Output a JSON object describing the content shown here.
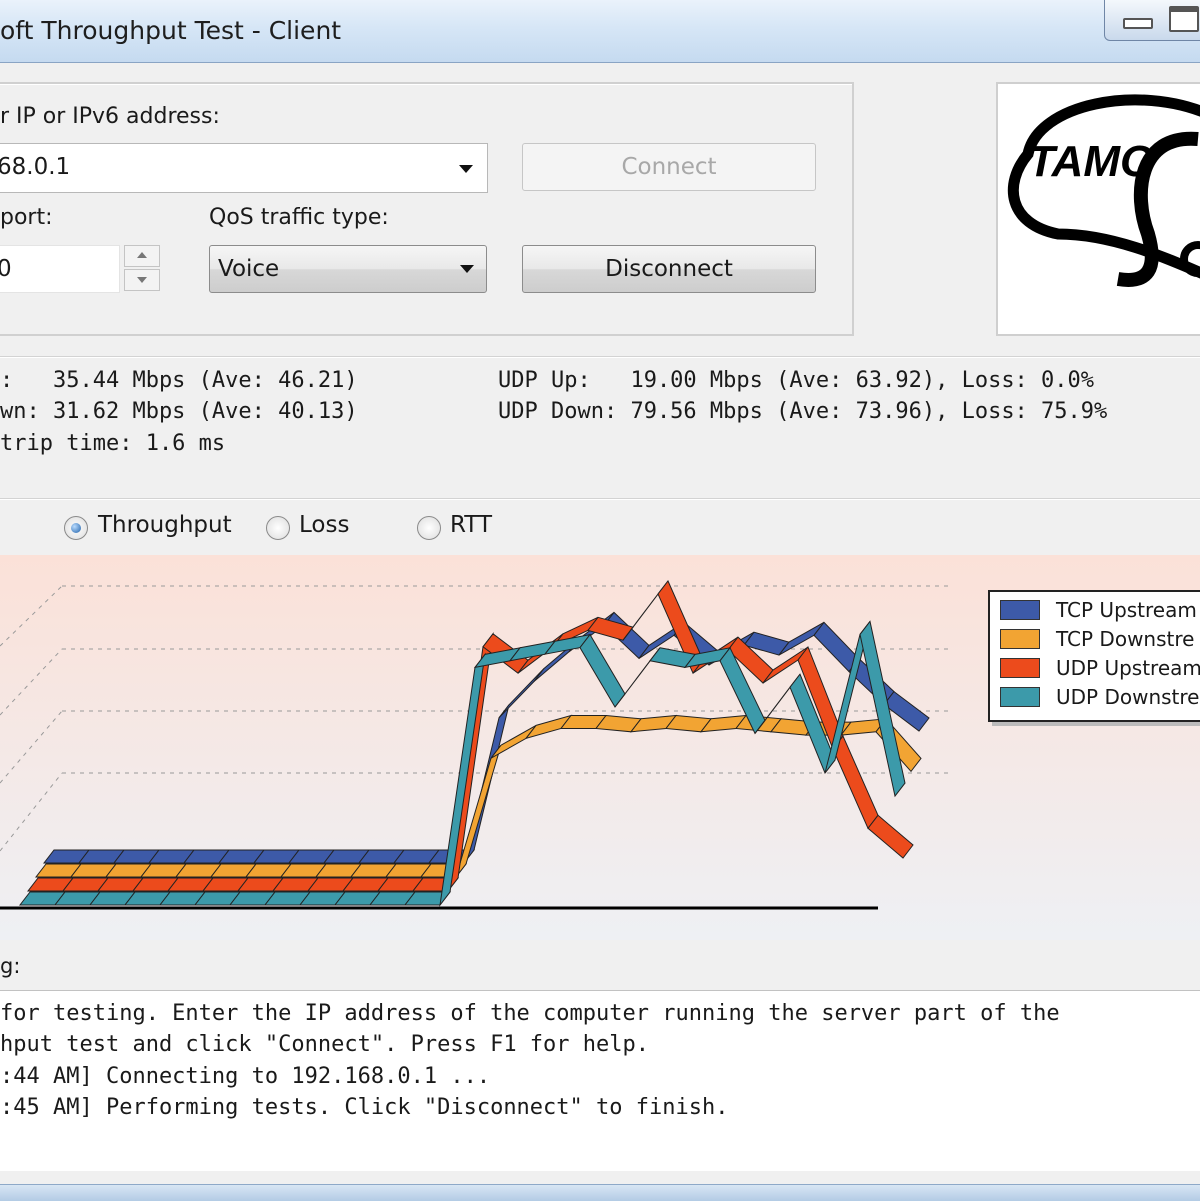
{
  "window": {
    "title": "oft Throughput Test - Client"
  },
  "connection": {
    "address_label": "r IP or IPv6  address:",
    "address_value": "68.0.1",
    "port_label": "port:",
    "port_value": "0",
    "qos_label": "QoS traffic type:",
    "qos_value": "Voice",
    "connect_label": "Connect",
    "disconnect_label": "Disconnect"
  },
  "logo": {
    "text": "TAMO"
  },
  "stats": {
    "line1_left": ":   35.44 Mbps (Ave: 46.21)",
    "line2_left": "wn: 31.62 Mbps (Ave: 40.13)",
    "line3_left": "trip time: 1.6 ms",
    "line1_right": "UDP Up:   19.00 Mbps (Ave: 63.92), Loss: 0.0%",
    "line2_right": "UDP Down: 79.56 Mbps (Ave: 73.96), Loss: 75.9%"
  },
  "view_options": [
    {
      "label": "Throughput",
      "selected": true
    },
    {
      "label": "Loss",
      "selected": false
    },
    {
      "label": "RTT",
      "selected": false
    }
  ],
  "legend": [
    {
      "label": "TCP Upstream",
      "color": "#3d5aa8"
    },
    {
      "label": "TCP Downstre",
      "color": "#f2a433"
    },
    {
      "label": "UDP Upstream",
      "color": "#ec4b1c"
    },
    {
      "label": "UDP Downstre",
      "color": "#3c9aaa"
    }
  ],
  "chart_data": {
    "type": "line",
    "title": "",
    "xlabel": "",
    "ylabel": "",
    "series": [
      {
        "name": "TCP Upstream",
        "values": [
          0,
          0,
          0,
          0,
          0,
          0,
          0,
          0,
          0,
          0,
          0,
          0,
          0,
          44,
          55,
          64,
          72,
          62,
          69,
          60,
          66,
          63,
          69,
          58,
          48,
          40
        ]
      },
      {
        "name": "TCP Downstream",
        "values": [
          0,
          0,
          0,
          0,
          0,
          0,
          0,
          0,
          0,
          0,
          0,
          0,
          0,
          36,
          42,
          45,
          45,
          44,
          45,
          44,
          45,
          44,
          43,
          43,
          44,
          32
        ]
      },
      {
        "name": "UDP Upstream",
        "values": [
          0,
          0,
          0,
          0,
          0,
          0,
          0,
          0,
          0,
          0,
          0,
          0,
          0,
          74,
          66,
          74,
          79,
          76,
          90,
          66,
          73,
          63,
          70,
          43,
          19,
          10
        ]
      },
      {
        "name": "UDP Downstream",
        "values": [
          0,
          0,
          0,
          0,
          0,
          0,
          0,
          0,
          0,
          0,
          0,
          0,
          0,
          72,
          74,
          76,
          78,
          60,
          74,
          72,
          74,
          52,
          66,
          40,
          82,
          33
        ]
      }
    ]
  },
  "log": {
    "label": "g:",
    "lines": [
      "for testing. Enter the IP address of the computer running the server part of the",
      "hput test and click \"Connect\". Press F1 for help.",
      ":44 AM] Connecting to 192.168.0.1 ...",
      ":45 AM] Performing tests. Click \"Disconnect\" to finish."
    ]
  }
}
